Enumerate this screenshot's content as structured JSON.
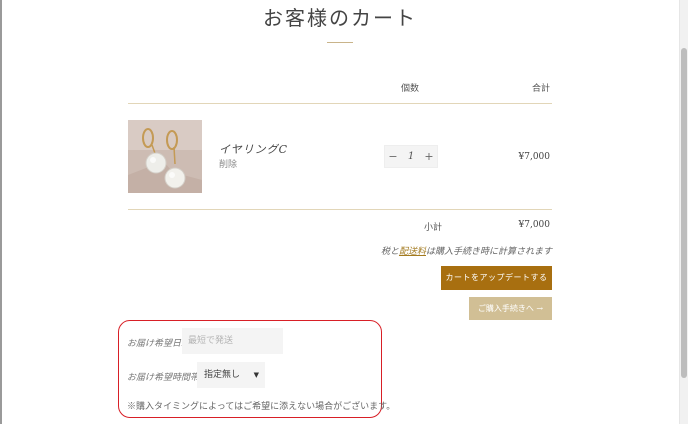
{
  "page": {
    "title": "お客様のカート"
  },
  "table": {
    "qty_header": "個数",
    "total_header": "合計"
  },
  "item": {
    "name": "イヤリングC",
    "remove": "削除",
    "quantity": "1",
    "price": "¥7,000"
  },
  "stepper": {
    "minus": "−",
    "plus": "+"
  },
  "summary": {
    "subtotal_label": "小計",
    "subtotal_value": "¥7,000",
    "tax_prefix": "税と",
    "tax_link": "配送料",
    "tax_suffix": "は購入手続き時に計算されます"
  },
  "buttons": {
    "update": "カートをアップデートする",
    "checkout": "ご購入手続きへ →"
  },
  "delivery": {
    "date_label": "お届け希望日:",
    "date_placeholder": "最短で発送",
    "time_label": "お届け希望時間帯:",
    "time_selected": "指定無し",
    "note": "※購入タイミングによってはご希望に添えない場合がございます。"
  },
  "colors": {
    "accent": "#a86f10",
    "checkout_button": "#d1bf95",
    "highlight_border": "#d81f26",
    "rule": "#e2d6b8"
  }
}
